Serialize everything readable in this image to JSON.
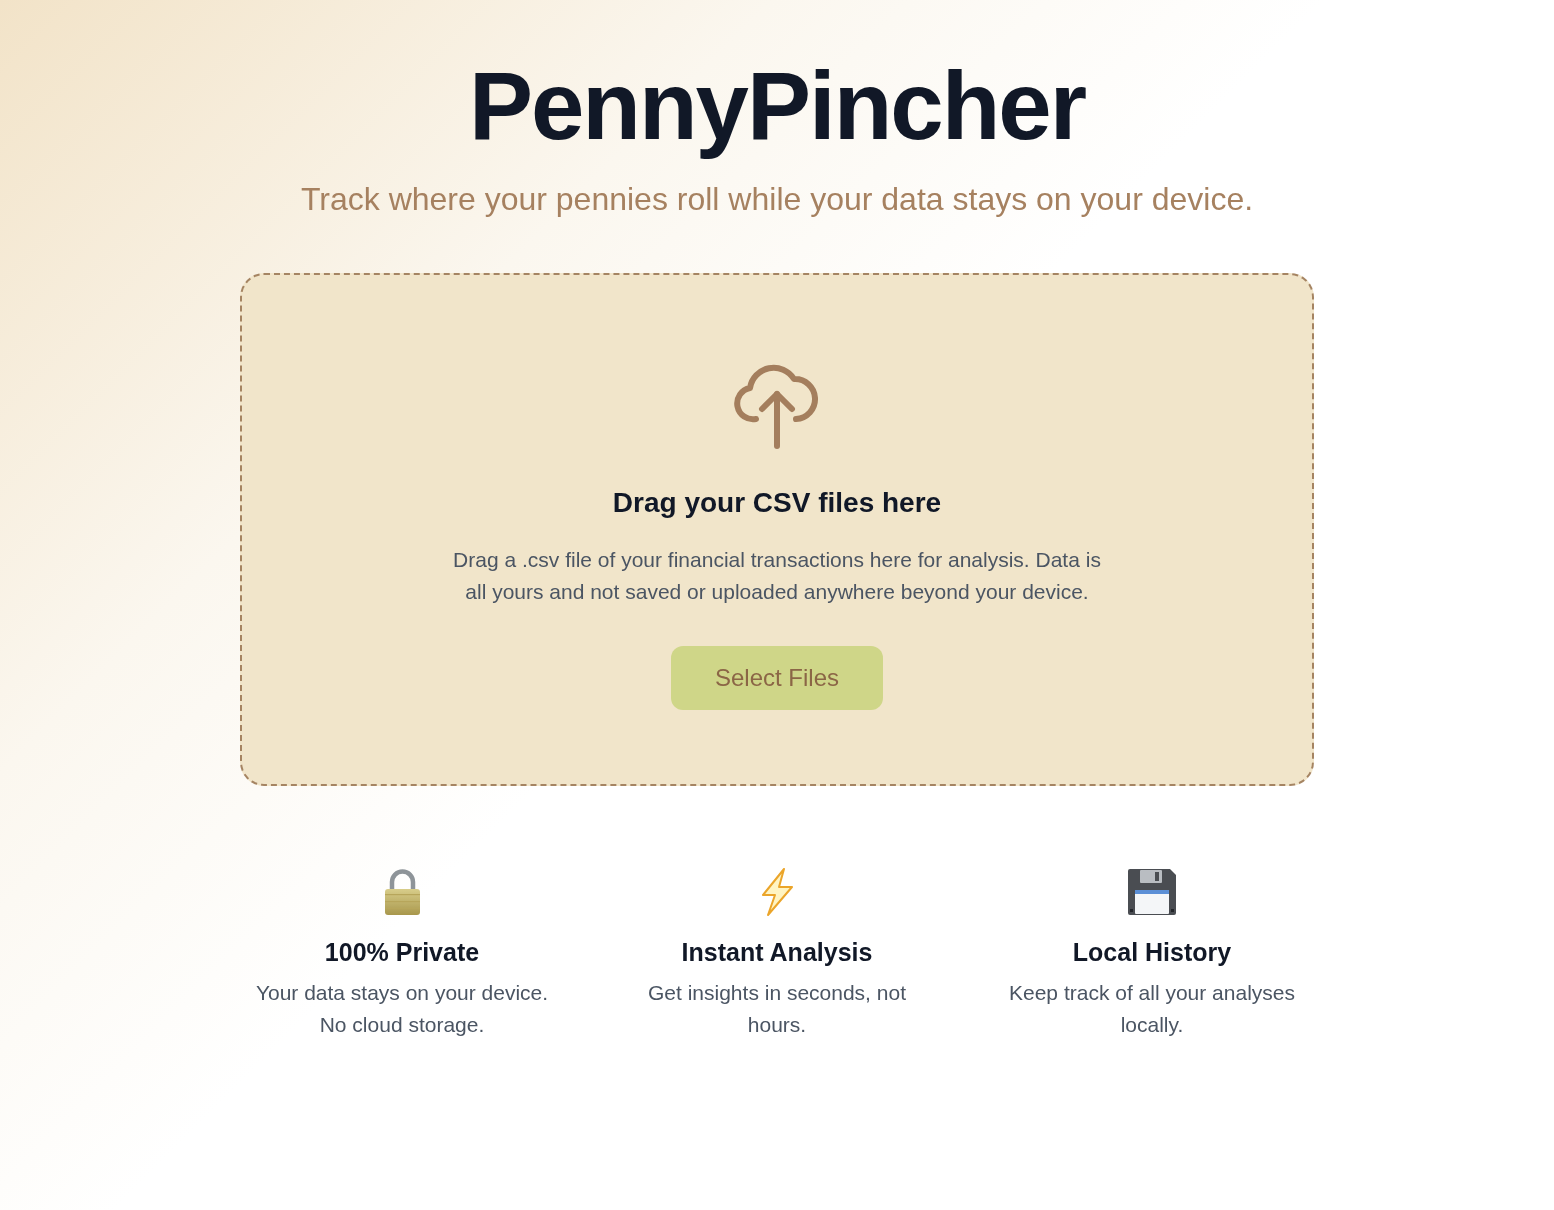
{
  "header": {
    "title": "PennyPincher",
    "tagline": "Track where your pennies roll while your data stays on your device."
  },
  "dropzone": {
    "heading": "Drag your CSV files here",
    "description": "Drag a .csv file of your financial transactions here for analysis. Data is all yours and not saved or uploaded anywhere beyond your device.",
    "button": "Select Files"
  },
  "features": [
    {
      "kind": "lock",
      "title": "100% Private",
      "description": "Your data stays on your device. No cloud storage."
    },
    {
      "kind": "bolt",
      "title": "Instant Analysis",
      "description": "Get insights in seconds, not hours."
    },
    {
      "kind": "disk",
      "title": "Local History",
      "description": "Keep track of all your analyses locally."
    }
  ]
}
